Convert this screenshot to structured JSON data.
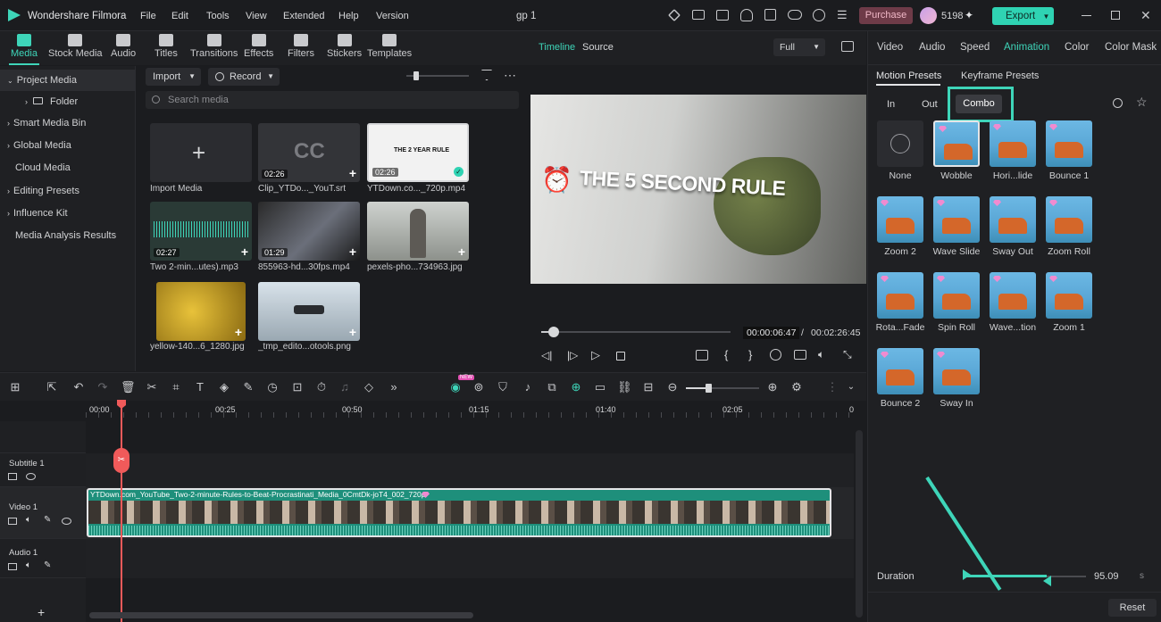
{
  "app": {
    "name": "Wondershare Filmora",
    "project": "gp 1"
  },
  "menu": [
    "File",
    "Edit",
    "Tools",
    "View",
    "Extended",
    "Help",
    "Version"
  ],
  "header": {
    "purchase": "Purchase",
    "credits": "5198",
    "export": "Export"
  },
  "toolbar_tabs": [
    "Media",
    "Stock Media",
    "Audio",
    "Titles",
    "Transitions",
    "Effects",
    "Filters",
    "Stickers",
    "Templates"
  ],
  "sidebar": {
    "items": [
      "Project Media",
      "Folder",
      "Smart Media Bin",
      "Global Media",
      "Cloud Media",
      "Editing Presets",
      "Influence Kit",
      "Media Analysis Results"
    ]
  },
  "media": {
    "import": "Import",
    "record": "Record",
    "search_placeholder": "Search media",
    "import_media": "Import Media",
    "items": [
      {
        "label": "Clip_YTDo..._YouT.srt",
        "duration": "02:26",
        "thumb_text": "CC"
      },
      {
        "label": "YTDown.co..._720p.mp4",
        "duration": "02:26",
        "thumb_text": "THE 2 YEAR RULE"
      },
      {
        "label": "Two 2-min...utes).mp3",
        "duration": "02:27"
      },
      {
        "label": "855963-hd...30fps.mp4",
        "duration": "01:29"
      },
      {
        "label": "pexels-pho...734963.jpg"
      },
      {
        "label": "yellow-140...6_1280.jpg"
      },
      {
        "label": "_tmp_edito...otools.png"
      }
    ]
  },
  "preview": {
    "tab_timeline": "Timeline",
    "tab_source": "Source",
    "quality": "Full",
    "overlay_text": "THE 5 SECOND RULE",
    "current_time": "00:00:06:47",
    "separator": "/",
    "total_time": "00:02:26:45",
    "progress_fraction": 0.04
  },
  "right_panel": {
    "tabs": [
      "Video",
      "Audio",
      "Speed",
      "Animation",
      "Color",
      "Color Mask"
    ],
    "subtabs": [
      "Motion Presets",
      "Keyframe Presets"
    ],
    "modes": [
      "In",
      "Out",
      "Combo"
    ],
    "presets": [
      "None",
      "Wobble",
      "Hori...lide",
      "Bounce 1",
      "Zoom 2",
      "Wave Slide",
      "Sway Out",
      "Zoom Roll",
      "Rota...Fade",
      "Spin Roll",
      "Wave...tion",
      "Zoom 1",
      "Bounce 2",
      "Sway In"
    ],
    "duration_label": "Duration",
    "duration_value": "95.09",
    "duration_unit": "s",
    "reset": "Reset"
  },
  "timeline": {
    "ruler": [
      "00:00",
      "00:25",
      "00:50",
      "01:15",
      "01:40",
      "02:05",
      "0"
    ],
    "tracks": [
      "Subtitle 1",
      "Video 1",
      "Audio 1"
    ],
    "clip_title": "YTDown.com_YouTube_Two-2-minute-Rules-to-Beat-Procrastinati_Media_0CmtDk-joT4_002_720p",
    "new_badge": "NEW"
  },
  "colors": {
    "accent": "#3ed5b9",
    "purchase": "#6e3b48",
    "export": "#2fd3b3",
    "clip": "#1e8f7b"
  }
}
